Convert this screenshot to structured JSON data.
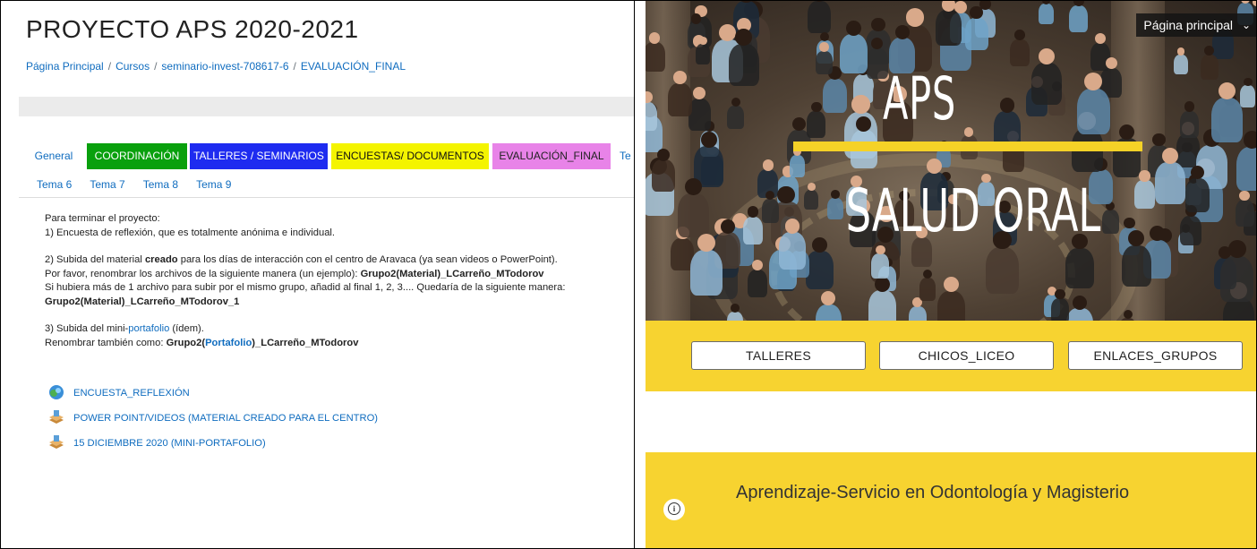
{
  "left": {
    "course_title": "PROYECTO APS 2020-2021",
    "breadcrumb": [
      "Página Principal",
      "Cursos",
      "seminario-invest-708617-6",
      "EVALUACIÓN_FINAL"
    ],
    "tabs_row1": [
      {
        "label": "General",
        "style": "plain"
      },
      {
        "label": "COORDINACIÓN",
        "style": "green",
        "color": "#09a00d"
      },
      {
        "label": "TALLERES / SEMINARIOS",
        "style": "blue",
        "color": "#1e2bf0"
      },
      {
        "label": "ENCUESTAS/ DOCUMENTOS",
        "style": "yellow",
        "color": "#f4f400"
      },
      {
        "label": "EVALUACIÓN_FINAL",
        "style": "pink",
        "color": "#e883e8"
      },
      {
        "label": "Te",
        "style": "plain"
      }
    ],
    "tabs_row2": [
      "Tema 6",
      "Tema 7",
      "Tema 8",
      "Tema 9"
    ],
    "content": {
      "intro": "Para terminar el proyecto:",
      "item1": "1) Encuesta de reflexión, que es totalmente anónima e individual.",
      "item2_a_pre": "2) Subida del material ",
      "item2_a_bold": "creado",
      "item2_a_post": " para los días de interacción con el centro de Aravaca (ya sean videos o PowerPoint).",
      "item2_b_pre": "Por favor, renombrar los archivos de la siguiente manera (un ejemplo): ",
      "item2_b_bold": "Grupo2(Material)_LCarreño_MTodorov",
      "item2_c": "Si hubiera más de 1 archivo para subir por el mismo grupo, añadid al final 1, 2, 3.... Quedaría de la siguiente manera:",
      "item2_d_bold": "Grupo2(Material)_LCarreño_MTodorov_1",
      "item3_a_pre": "3) Subida del mini-",
      "item3_a_link": "portafolio",
      "item3_a_post": " (ídem).",
      "item3_b_pre": "Renombrar también como: ",
      "item3_b_bold1": "Grupo2(",
      "item3_b_link": "Portafolio",
      "item3_b_bold2": ")_LCarreño_MTodorov"
    },
    "activities": [
      {
        "label": "ENCUESTA_REFLEXIÓN",
        "icon": "feedback-icon"
      },
      {
        "label": "POWER POINT/VIDEOS (MATERIAL CREADO PARA EL CENTRO)",
        "icon": "assignment-icon"
      },
      {
        "label": "15 DICIEMBRE 2020 (MINI-PORTAFOLIO)",
        "icon": "assignment-icon"
      }
    ]
  },
  "right": {
    "nav_label": "Página principal",
    "hero_title": "APS",
    "hero_subtitle": "SALUD ORAL",
    "accent_color": "#f7d330",
    "buttons": [
      "TALLERES",
      "CHICOS_LICEO",
      "ENLACES_GRUPOS"
    ],
    "tagline": "Aprendizaje-Servicio en Odontología y Magisterio"
  }
}
